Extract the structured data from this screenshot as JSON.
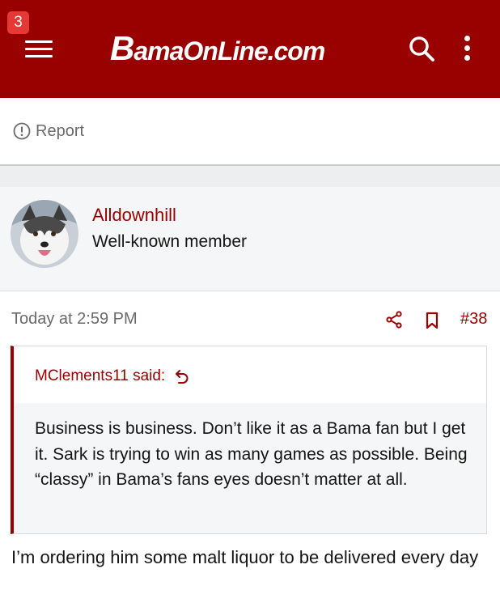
{
  "header": {
    "notification_count": "3",
    "logo_text_big": "B",
    "logo_text_rest": "amaOnLine.com",
    "brand_color": "#990000"
  },
  "toolbar": {
    "report_label": "Report"
  },
  "user": {
    "name": "Alldownhill",
    "title": "Well-known member",
    "avatar_icon": "husky-dog-avatar"
  },
  "post": {
    "time": "Today at 2:59 PM",
    "number": "#38",
    "quote": {
      "author": "MClements11 said:",
      "text": "Business is business. Don’t like it as a Bama fan but I get it. Sark is trying to win as many games as possible. Being “classy” in Bama’s fans eyes doesn’t matter at all."
    },
    "text": "I’m ordering him some malt liquor to be delivered every day"
  }
}
